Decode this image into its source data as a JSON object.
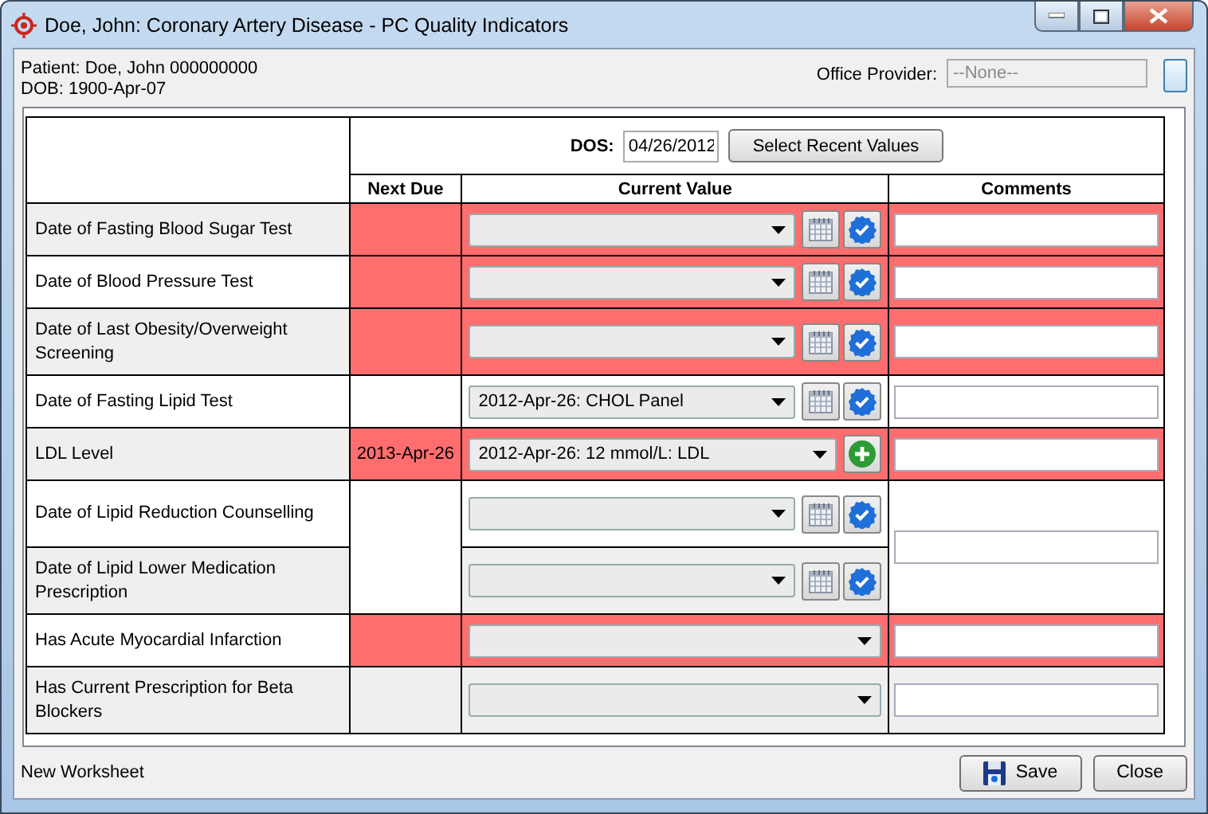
{
  "window": {
    "title": "Doe, John: Coronary Artery Disease - PC Quality Indicators"
  },
  "patient": {
    "name_line": "Patient: Doe, John  000000000",
    "dob": "DOB: 1900-Apr-07"
  },
  "office_provider": {
    "label": "Office Provider:",
    "placeholder": "--None--",
    "disabled": true
  },
  "dos": {
    "label": "DOS:",
    "value": "04/26/2012",
    "button": "Select Recent Values"
  },
  "columns": [
    "Next Due",
    "Current Value",
    "Comments"
  ],
  "rows": [
    {
      "flagged": true,
      "measures": [
        {
          "label": "Date of Fasting Blood Sugar Test",
          "actions": [
            {
              "kind": "calendar"
            },
            {
              "kind": "verify"
            }
          ]
        }
      ]
    },
    {
      "flagged": true,
      "measures": [
        {
          "label": "Date of Blood Pressure Test",
          "actions": [
            {
              "kind": "calendar"
            },
            {
              "kind": "verify"
            }
          ]
        }
      ]
    },
    {
      "flagged": true,
      "measures": [
        {
          "label": "Date of Last Obesity/Overweight Screening",
          "actions": [
            {
              "kind": "calendar"
            },
            {
              "kind": "verify"
            }
          ]
        }
      ]
    },
    {
      "flagged": false,
      "measures": [
        {
          "label": "Date of Fasting Lipid Test",
          "value": "2012-Apr-26: CHOL Panel",
          "actions": [
            {
              "kind": "calendar"
            },
            {
              "kind": "verify"
            }
          ]
        }
      ]
    },
    {
      "flagged": true,
      "next_due": "2013-Apr-26",
      "measures": [
        {
          "label": "LDL Level",
          "value": "2012-Apr-26: 12 mmol/L: LDL",
          "actions": [
            {
              "kind": "add"
            }
          ]
        }
      ]
    },
    {
      "flagged": false,
      "measures": [
        {
          "label": "Date of Lipid Reduction Counselling",
          "actions": [
            {
              "kind": "calendar"
            },
            {
              "kind": "verify"
            }
          ]
        },
        {
          "label": "Date of Lipid Lower Medication Prescription",
          "actions": [
            {
              "kind": "calendar"
            },
            {
              "kind": "verify"
            }
          ]
        }
      ]
    },
    {
      "flagged": true,
      "measures": [
        {
          "label": "Has Acute Myocardial Infarction"
        }
      ]
    },
    {
      "flagged": false,
      "measures": [
        {
          "label": "Has Current Prescription for Beta Blockers"
        }
      ]
    }
  ],
  "status": "New Worksheet",
  "buttons": [
    {
      "label": "Save",
      "kind": "save"
    },
    {
      "label": "Close",
      "kind": "plain"
    }
  ]
}
